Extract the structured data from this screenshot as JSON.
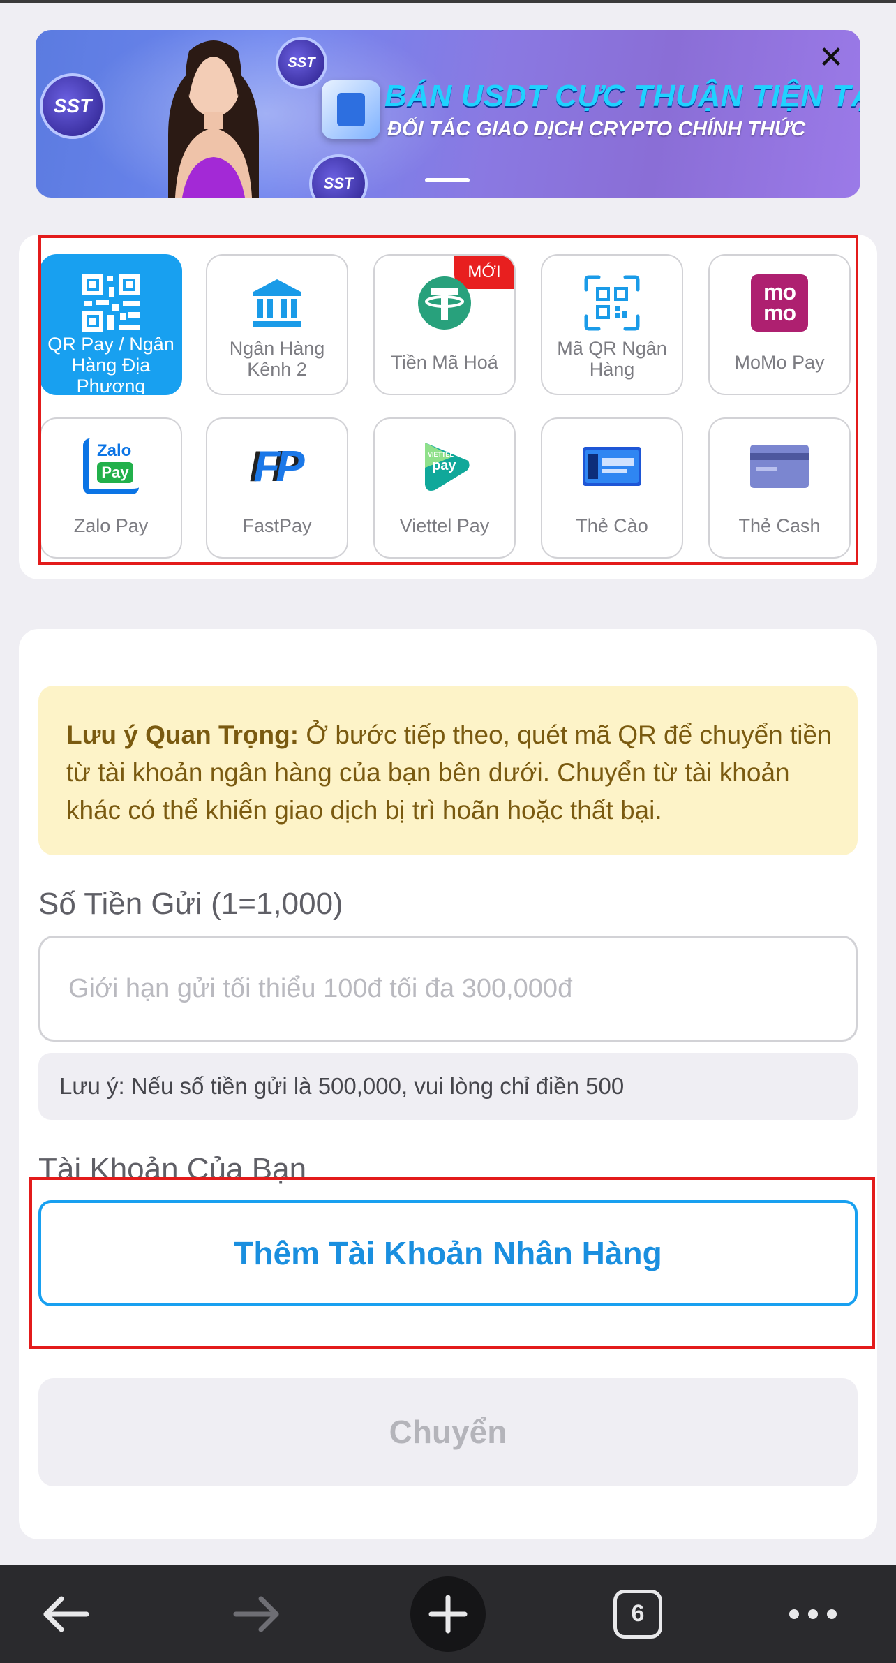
{
  "banner": {
    "title": "BÁN USDT CỰC THUẬN TIỆN TẠI SST",
    "subtitle": "ĐỐI TÁC GIAO DỊCH CRYPTO CHÍNH THỨC",
    "coin_text": "SST",
    "close_icon": "close-icon"
  },
  "payment_methods": {
    "items": [
      {
        "label": "QR Pay / Ngân Hàng Địa Phương",
        "icon": "qr-code-icon",
        "selected": true
      },
      {
        "label": "Ngân Hàng Kênh 2",
        "icon": "bank-icon"
      },
      {
        "label": "Tiền Mã Hoá",
        "icon": "tether-icon",
        "badge": "MỚI"
      },
      {
        "label": "Mã QR Ngân Hàng",
        "icon": "qr-scan-icon"
      },
      {
        "label": "MoMo Pay",
        "icon": "momo-icon",
        "logo_text": "mo mo"
      },
      {
        "label": "Zalo Pay",
        "icon": "zalopay-icon",
        "logo_text_1": "Zalo",
        "logo_text_2": "Pay"
      },
      {
        "label": "FastPay",
        "icon": "fastpay-icon",
        "logo_text": "FP"
      },
      {
        "label": "Viettel Pay",
        "icon": "viettelpay-icon",
        "logo_text_1": "VIETTEL",
        "logo_text_2": "pay"
      },
      {
        "label": "Thẻ Cào",
        "icon": "scratch-card-icon"
      },
      {
        "label": "Thẻ Cash",
        "icon": "cash-card-icon"
      }
    ]
  },
  "notice": {
    "bold": "Lưu ý Quan Trọng:",
    "text": " Ở bước tiếp theo, quét mã QR để chuyển tiền từ tài khoản ngân hàng của bạn bên dưới. Chuyển từ tài khoản khác có thể khiến giao dịch bị trì hoãn hoặc thất bại."
  },
  "deposit": {
    "amount_label": "Số Tiền Gửi (1=1,000)",
    "amount_placeholder": "Giới hạn gửi tối thiểu 100đ tối đa 300,000đ",
    "amount_value": "",
    "hint": "Lưu ý: Nếu số tiền gửi là 500,000, vui lòng chỉ điền 500",
    "account_label": "Tài Khoản Của Bạn",
    "add_bank_label": "Thêm Tài Khoản Nhân Hàng",
    "transfer_label": "Chuyển"
  },
  "toolbar": {
    "tab_count": "6",
    "icons": [
      "back-arrow-icon",
      "forward-arrow-icon",
      "new-tab-plus-icon",
      "tab-switcher-icon",
      "more-dots-icon"
    ]
  },
  "colors": {
    "accent": "#18a0f0",
    "highlight": "#e31b1b",
    "notice_bg": "#fdf3c8",
    "notice_text": "#7a5a10",
    "page_bg": "#efeef3",
    "toolbar_bg": "#2a2a2d"
  }
}
